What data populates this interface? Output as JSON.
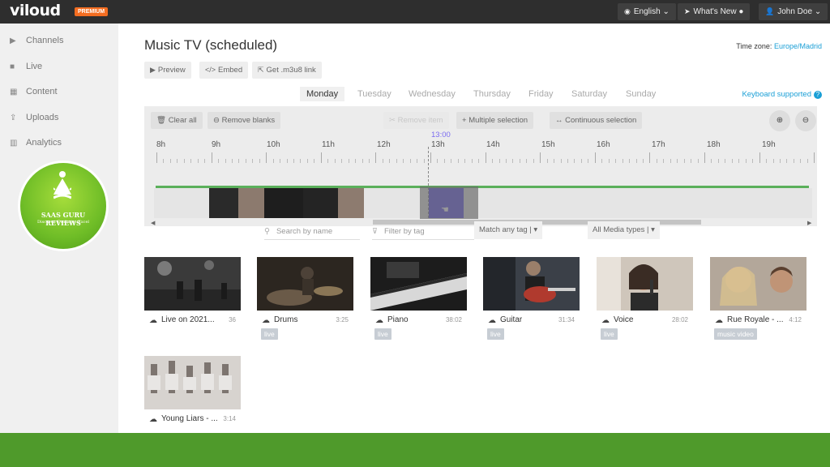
{
  "app": {
    "logo": "viloud",
    "badge": "PREMIUM"
  },
  "topbar": {
    "language": "English",
    "whats_new": "What's New",
    "user": "John Doe"
  },
  "sidebar": {
    "items": [
      {
        "label": "Channels",
        "icon": "play-icon"
      },
      {
        "label": "Live",
        "icon": "camera-icon"
      },
      {
        "label": "Content",
        "icon": "grid-icon"
      },
      {
        "label": "Uploads",
        "icon": "upload-icon"
      },
      {
        "label": "Analytics",
        "icon": "chart-icon"
      }
    ]
  },
  "page": {
    "title": "Music TV (scheduled)",
    "timezone_label": "Time zone:",
    "timezone_value": "Europe/Madrid",
    "actions": {
      "preview": "Preview",
      "embed": "Embed",
      "m3u8": "Get .m3u8 link"
    },
    "keyboard": "Keyboard supported"
  },
  "days": [
    "Monday",
    "Tuesday",
    "Wednesday",
    "Thursday",
    "Friday",
    "Saturday",
    "Sunday"
  ],
  "active_day": "Monday",
  "timeline": {
    "clear_all": "Clear all",
    "remove_blanks": "Remove blanks",
    "remove_item": "Remove item",
    "multiple_selection": "Multiple selection",
    "continuous_selection": "Continuous selection",
    "hours": [
      "8h",
      "9h",
      "10h",
      "11h",
      "12h",
      "13h",
      "14h",
      "15h",
      "16h",
      "17h",
      "18h",
      "19h"
    ],
    "now_label": "13:00",
    "clips": [
      {
        "color": "#2a2a2a"
      },
      {
        "color": "#8c7a6e"
      },
      {
        "color": "#1e1e1e"
      },
      {
        "color": "#242424"
      },
      {
        "color": "#8d7b6f"
      },
      {
        "color": "#5548e8"
      }
    ]
  },
  "filters": {
    "search_placeholder": "Search by name",
    "tag_placeholder": "Filter by tag",
    "match": "Match any tag",
    "media_types": "All Media types"
  },
  "media": [
    {
      "name": "Live on 2021...",
      "duration": "36",
      "tag": "",
      "scheduled": false
    },
    {
      "name": "Drums",
      "duration": "3:25",
      "tag": "live",
      "scheduled": true
    },
    {
      "name": "Piano",
      "duration": "38:02",
      "tag": "live",
      "scheduled": true
    },
    {
      "name": "Guitar",
      "duration": "31:34",
      "tag": "live",
      "scheduled": true
    },
    {
      "name": "Voice",
      "duration": "28:02",
      "tag": "live",
      "scheduled": true
    },
    {
      "name": "Rue Royale - ...",
      "duration": "4:12",
      "tag": "music video",
      "scheduled": false
    },
    {
      "name": "Young Liars - ...",
      "duration": "3:14",
      "tag": "",
      "scheduled": false
    }
  ],
  "watermark": {
    "title": "SAAS GURU REVIEWS",
    "tagline": "Discover. Evaluate. Excel"
  },
  "colors": {
    "accent": "#1a9fd6",
    "selected_clip": "#5548e8",
    "timeline_green": "#5bb05b",
    "footer": "#4f9a2b"
  }
}
